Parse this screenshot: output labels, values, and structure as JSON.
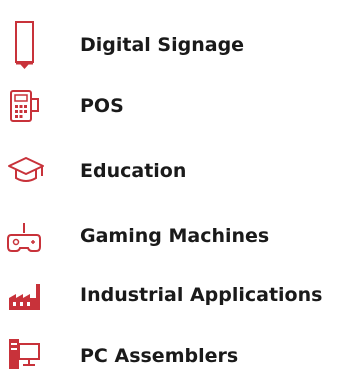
{
  "accent_color": "#c8323a",
  "items": [
    {
      "label": "Digital Signage",
      "icon": "digital-signage-icon"
    },
    {
      "label": "POS",
      "icon": "pos-terminal-icon"
    },
    {
      "label": "Education",
      "icon": "graduation-cap-icon"
    },
    {
      "label": "Gaming Machines",
      "icon": "gaming-controller-icon"
    },
    {
      "label": "Industrial Applications",
      "icon": "factory-icon"
    },
    {
      "label": "PC Assemblers",
      "icon": "desktop-pc-icon"
    }
  ]
}
